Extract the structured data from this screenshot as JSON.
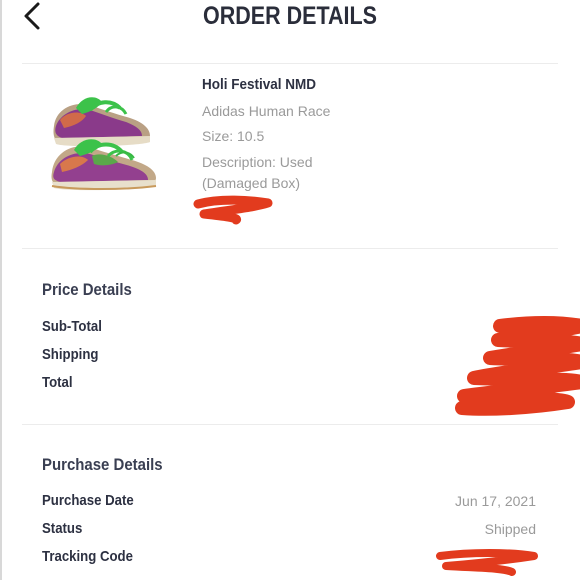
{
  "header": {
    "title": "ORDER DETAILS",
    "back_icon": "chevron-left-icon"
  },
  "product": {
    "name": "Holi Festival NMD",
    "brand": "Adidas Human Race",
    "size": "Size: 10.5",
    "description_line1": "Description: Used",
    "description_line2": "(Damaged Box)",
    "image": "sneaker-pair-image"
  },
  "price_details": {
    "title": "Price Details",
    "subtotal_label": "Sub-Total",
    "shipping_label": "Shipping",
    "total_label": "Total"
  },
  "purchase_details": {
    "title": "Purchase Details",
    "date_label": "Purchase Date",
    "date_value": "Jun 17, 2021",
    "status_label": "Status",
    "status_value": "Shipped",
    "tracking_label": "Tracking Code"
  },
  "colors": {
    "redaction": "#e23b1e",
    "text_dark": "#2d3142",
    "text_muted": "#9a9a9a",
    "divider": "#ececec"
  }
}
